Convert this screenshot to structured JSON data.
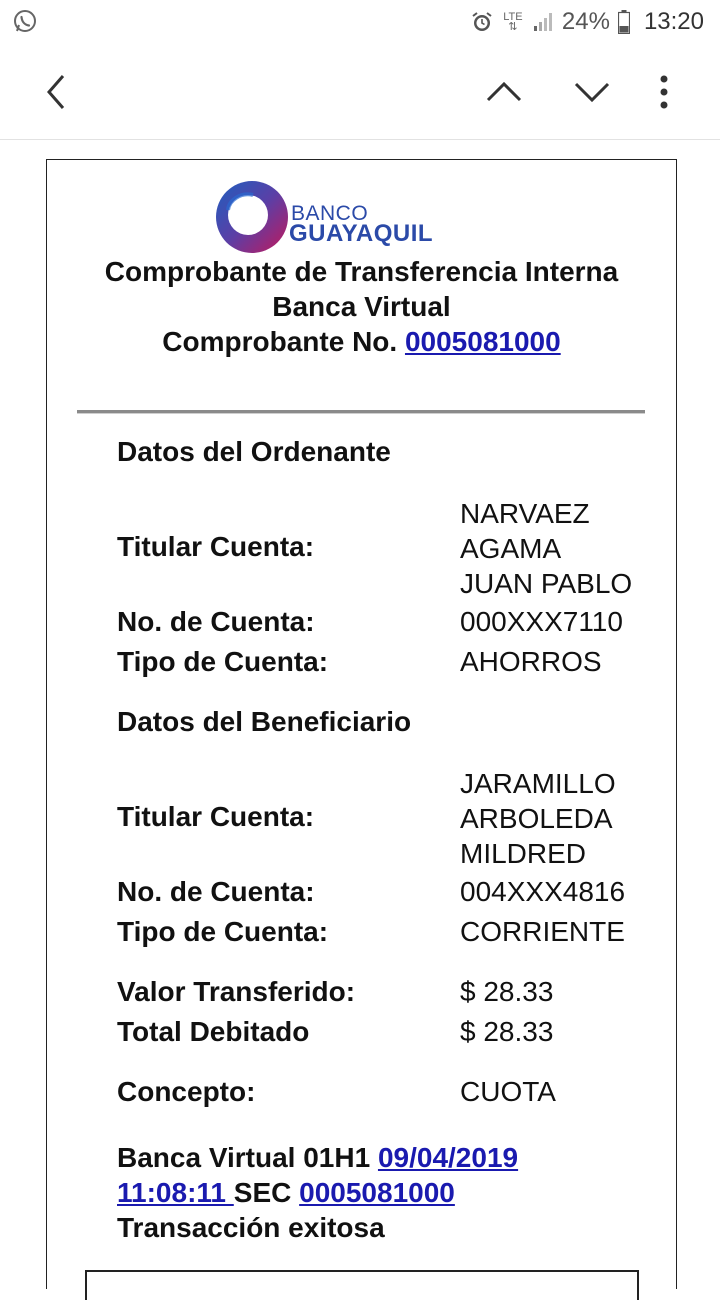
{
  "status_bar": {
    "network": "LTE",
    "battery_percent": "24%",
    "time": "13:20"
  },
  "receipt": {
    "bank_name_line1": "BANCO",
    "bank_name_line2": "GUAYAQUIL",
    "title_line1": "Comprobante de Transferencia Interna",
    "title_line2": "Banca Virtual",
    "title_line3_prefix": "Comprobante No. ",
    "receipt_number": "0005081000",
    "ordenante": {
      "heading": "Datos del Ordenante",
      "holder_label": "Titular Cuenta:",
      "holder_value_lines": [
        "NARVAEZ",
        "AGAMA",
        "JUAN PABLO"
      ],
      "account_label": "No. de Cuenta:",
      "account_value": "000XXX7110",
      "type_label": "Tipo de Cuenta:",
      "type_value": "AHORROS"
    },
    "beneficiario": {
      "heading": "Datos del Beneficiario",
      "holder_label": "Titular Cuenta:",
      "holder_value_lines": [
        "JARAMILLO",
        "ARBOLEDA",
        "MILDRED"
      ],
      "account_label": "No. de Cuenta:",
      "account_value": "004XXX4816",
      "type_label": "Tipo de Cuenta:",
      "type_value": "CORRIENTE"
    },
    "amounts": {
      "transferred_label": "Valor Transferido:",
      "transferred_value": "$ 28.33",
      "debited_label": "Total Debitado",
      "debited_value": "$ 28.33"
    },
    "concept_label": "Concepto:",
    "concept_value": "CUOTA",
    "footer": {
      "prefix": "Banca Virtual 01H1 ",
      "date": "09/04/2019",
      "time": "11:08:11 ",
      "sec_label": "SEC ",
      "sec_number": "0005081000",
      "result": "Transacción exitosa"
    }
  },
  "colors": {
    "link": "#1a1aaf",
    "brand_blue": "#2b4aa8",
    "brand_magenta": "#c2185b"
  },
  "icons": [
    "whatsapp-icon",
    "alarm-icon",
    "signal-icon",
    "battery-icon",
    "back-arrow-icon",
    "chevron-up-icon",
    "chevron-down-icon",
    "more-vert-icon"
  ]
}
